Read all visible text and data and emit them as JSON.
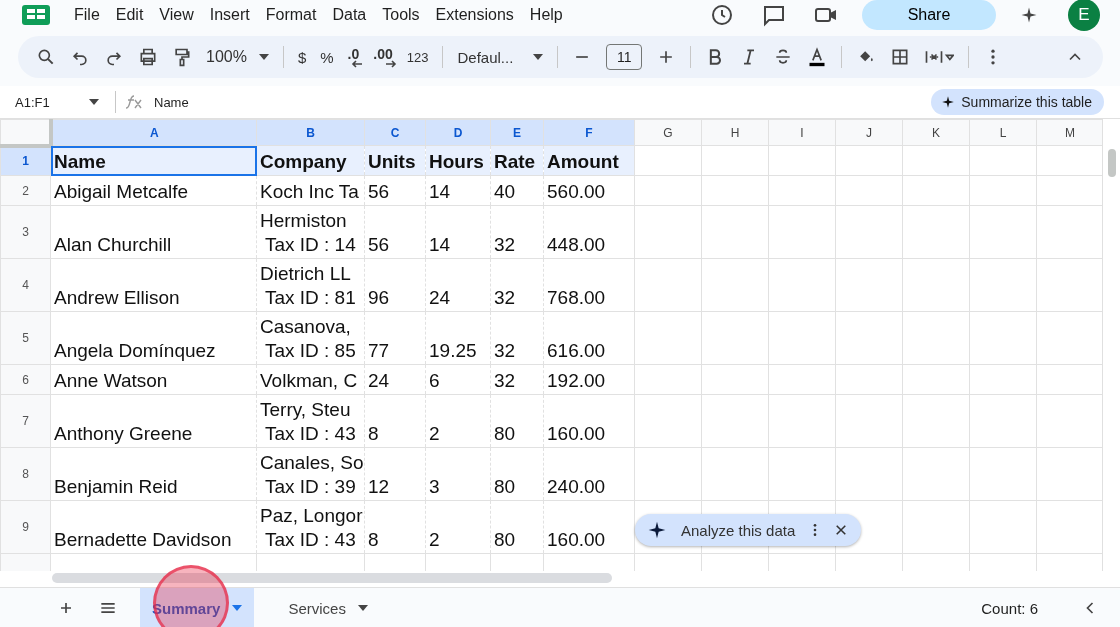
{
  "menu": [
    "File",
    "Edit",
    "View",
    "Insert",
    "Format",
    "Data",
    "Tools",
    "Extensions",
    "Help"
  ],
  "share": "Share",
  "avatar": "E",
  "toolbar": {
    "zoom": "100%",
    "currency": "$",
    "percent": "%",
    "decrease_decimals": ".0",
    "increase_decimals": ".00",
    "number_format": "123",
    "font": "Defaul...",
    "font_size": "11"
  },
  "name_box": "A1:F1",
  "formula": "Name",
  "summarize": "Summarize this table",
  "columns": [
    {
      "label": "A",
      "selected": true
    },
    {
      "label": "B",
      "selected": true
    },
    {
      "label": "C",
      "selected": true
    },
    {
      "label": "D",
      "selected": true
    },
    {
      "label": "E",
      "selected": true
    },
    {
      "label": "F",
      "selected": true
    },
    {
      "label": "G",
      "selected": false
    },
    {
      "label": "H",
      "selected": false
    },
    {
      "label": "I",
      "selected": false
    },
    {
      "label": "J",
      "selected": false
    },
    {
      "label": "K",
      "selected": false
    },
    {
      "label": "L",
      "selected": false
    },
    {
      "label": "M",
      "selected": false
    }
  ],
  "rows": [
    {
      "number": "1",
      "selected": true,
      "header": true,
      "cells": [
        "Name",
        "Company",
        "Units",
        "Hours",
        "Rate",
        "Amount"
      ]
    },
    {
      "number": "2",
      "selected": false,
      "header": false,
      "cells": [
        "Abigail Metcalfe",
        "Koch Inc Ta",
        "56",
        "14",
        "40",
        "560.00"
      ]
    },
    {
      "number": "3",
      "selected": false,
      "header": false,
      "cells": [
        "Alan Churchill",
        "Hermiston\n Tax ID : 14",
        "56",
        "14",
        "32",
        "448.00"
      ]
    },
    {
      "number": "4",
      "selected": false,
      "header": false,
      "cells": [
        "Andrew Ellison",
        "Dietrich LL\n Tax ID : 81",
        "96",
        "24",
        "32",
        "768.00"
      ]
    },
    {
      "number": "5",
      "selected": false,
      "header": false,
      "cells": [
        "Angela Domínquez",
        "Casanova, \n Tax ID : 85",
        "77",
        "19.25",
        "32",
        "616.00"
      ]
    },
    {
      "number": "6",
      "selected": false,
      "header": false,
      "cells": [
        "Anne Watson",
        "Volkman, C",
        "24",
        "6",
        "32",
        "192.00"
      ]
    },
    {
      "number": "7",
      "selected": false,
      "header": false,
      "cells": [
        "Anthony Greene",
        "Terry, Steu\n Tax ID : 43",
        "8",
        "2",
        "80",
        "160.00"
      ]
    },
    {
      "number": "8",
      "selected": false,
      "header": false,
      "cells": [
        "Benjamin Reid",
        "Canales, So\n Tax ID : 39",
        "12",
        "3",
        "80",
        "240.00"
      ]
    },
    {
      "number": "9",
      "selected": false,
      "header": false,
      "cells": [
        "Bernadette Davidson",
        "Paz, Longor\n Tax ID : 43",
        "8",
        "2",
        "80",
        "160.00"
      ]
    }
  ],
  "analyze": "Analyze this data",
  "sheets": [
    {
      "label": "Summary",
      "selected": true
    },
    {
      "label": "Services",
      "selected": false
    }
  ],
  "status": "Count: 6"
}
